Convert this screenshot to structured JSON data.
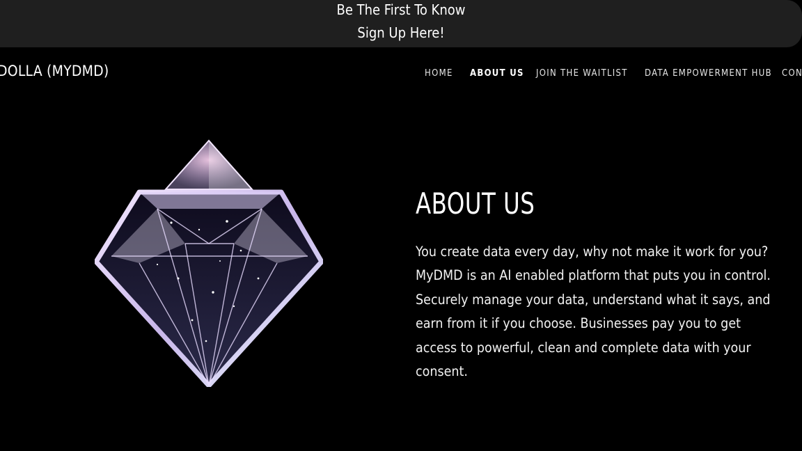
{
  "announcement": {
    "line1": "Be The First To Know",
    "line2": "Sign Up Here!"
  },
  "header": {
    "brand": "DOLLA (MYDMD)",
    "nav": [
      {
        "label": "HOME",
        "active": false
      },
      {
        "label": "ABOUT US",
        "active": true
      },
      {
        "label": "JOIN THE WAITLIST",
        "active": false
      },
      {
        "label": "DATA EMPOWERMENT HUB",
        "active": false
      },
      {
        "label": "CONT",
        "active": false
      }
    ]
  },
  "about": {
    "title": "ABOUT US",
    "body": "You create data every day, why not make it work for you? MyDMD is an AI enabled platform that puts you in control. Securely manage your data, understand what it says, and earn from it if you choose. Businesses pay you to get access to powerful, clean and complete data with your consent."
  },
  "colors": {
    "background": "#000000",
    "banner": "#1f1f1f",
    "text": "#ffffff"
  },
  "icons": {
    "hero": "diamond-icon"
  }
}
